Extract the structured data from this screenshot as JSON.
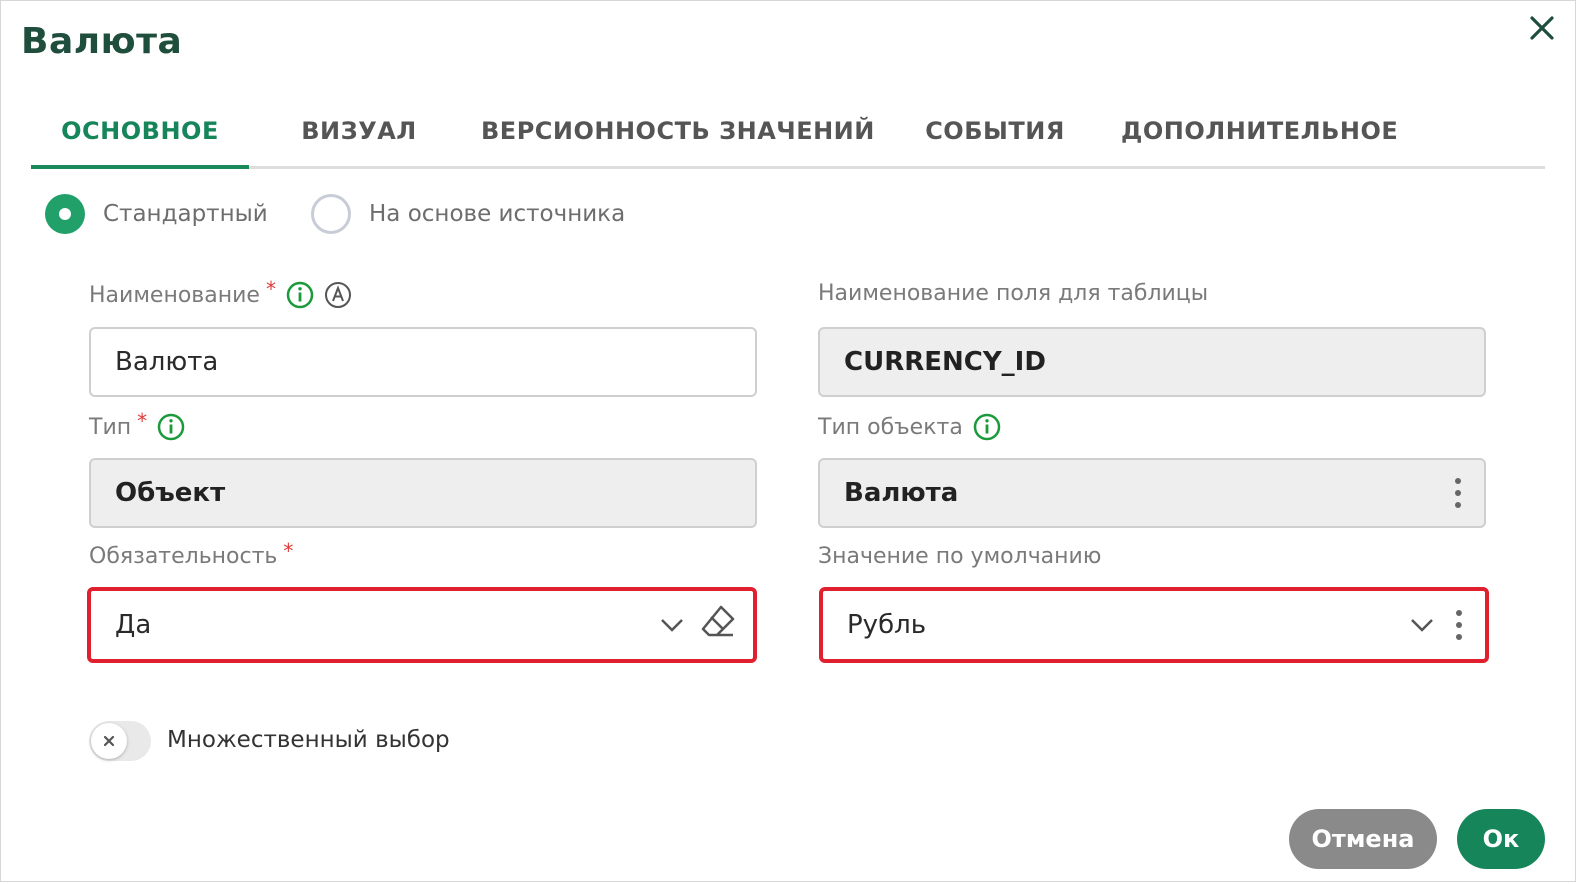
{
  "dialog": {
    "title": "Валюта"
  },
  "tabs": [
    {
      "label": "ОСНОВНОЕ",
      "active": true
    },
    {
      "label": "ВИЗУАЛ",
      "active": false
    },
    {
      "label": "ВЕРСИОННОСТЬ ЗНАЧЕНИЙ",
      "active": false
    },
    {
      "label": "СОБЫТИЯ",
      "active": false
    },
    {
      "label": "ДОПОЛНИТЕЛЬНОЕ",
      "active": false
    }
  ],
  "mode": {
    "options": [
      {
        "label": "Стандартный",
        "selected": true
      },
      {
        "label": "На основе источника",
        "selected": false
      }
    ]
  },
  "fields": {
    "name": {
      "label": "Наименование",
      "required": "*",
      "value": "Валюта"
    },
    "table_field": {
      "label": "Наименование поля для таблицы",
      "value": "CURRENCY_ID"
    },
    "type": {
      "label": "Тип",
      "required": "*",
      "value": "Объект"
    },
    "object_type": {
      "label": "Тип объекта",
      "value": "Валюта"
    },
    "mandatory": {
      "label": "Обязательность",
      "required": "*",
      "value": "Да"
    },
    "default_value": {
      "label": "Значение по умолчанию",
      "value": "Рубль"
    }
  },
  "multi_select": {
    "label": "Множественный выбор",
    "enabled": false
  },
  "buttons": {
    "cancel": "Отмена",
    "ok": "Ок"
  },
  "colors": {
    "accent": "#16855a",
    "radio": "#21a06a",
    "highlight": "#e01f2f",
    "required": "#e03a3a",
    "cancel": "#8a8a8a"
  }
}
